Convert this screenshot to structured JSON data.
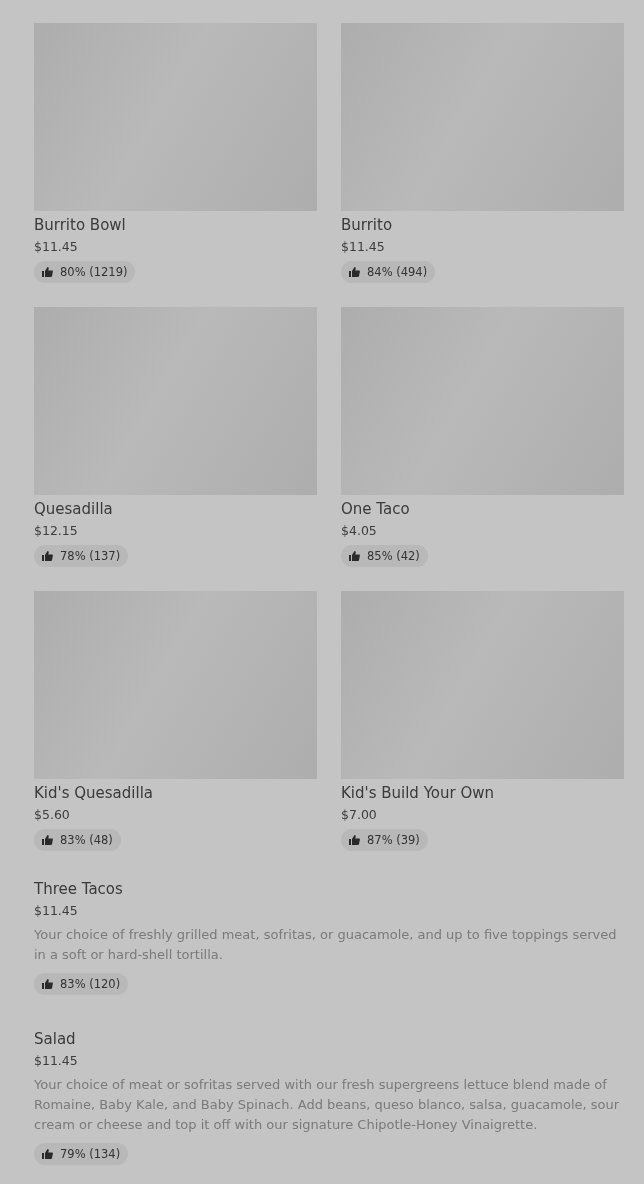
{
  "grid_items": [
    {
      "name": "Burrito Bowl",
      "price": "$11.45",
      "rating": "80% (1219)"
    },
    {
      "name": "Burrito",
      "price": "$11.45",
      "rating": "84% (494)"
    },
    {
      "name": "Quesadilla",
      "price": "$12.15",
      "rating": "78% (137)"
    },
    {
      "name": "One Taco",
      "price": "$4.05",
      "rating": "85% (42)"
    },
    {
      "name": "Kid's Quesadilla",
      "price": "$5.60",
      "rating": "83% (48)"
    },
    {
      "name": "Kid's Build Your Own",
      "price": "$7.00",
      "rating": "87% (39)"
    }
  ],
  "list_items": [
    {
      "name": "Three Tacos",
      "price": "$11.45",
      "description": "Your choice of freshly grilled meat, sofritas, or guacamole, and up to five toppings served in a soft or hard-shell tortilla.",
      "rating": "83% (120)"
    },
    {
      "name": "Salad",
      "price": "$11.45",
      "description": "Your choice of meat or sofritas served with our fresh supergreens lettuce blend made of Romaine, Baby Kale, and Baby Spinach. Add beans, queso blanco, salsa, guacamole, sour cream or cheese and top it off with our signature Chipotle-Honey Vinaigrette.",
      "rating": "79% (134)"
    }
  ]
}
